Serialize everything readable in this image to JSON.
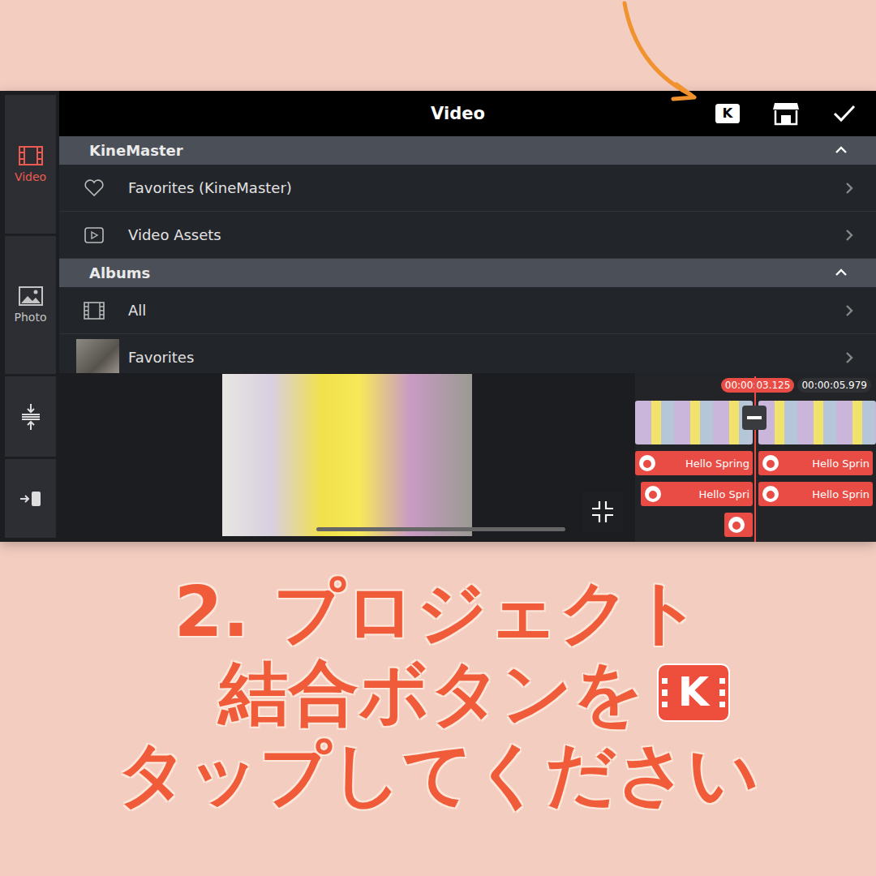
{
  "logo_letter": "K",
  "header": {
    "title": "Video"
  },
  "sidebar": {
    "tabs": [
      {
        "label": "Video",
        "selected": true
      },
      {
        "label": "Photo",
        "selected": false
      }
    ]
  },
  "sections": [
    {
      "title": "KineMaster",
      "expanded": true,
      "rows": [
        {
          "label": "Favorites (KineMaster)",
          "kind": "heart"
        },
        {
          "label": "Video Assets",
          "kind": "play"
        }
      ]
    },
    {
      "title": "Albums",
      "expanded": true,
      "rows": [
        {
          "label": "All",
          "kind": "film"
        },
        {
          "label": "Favorites",
          "kind": "thumbnail"
        }
      ]
    }
  ],
  "timeline": {
    "playhead": "00:00:03.125",
    "end": "00:00:05.979",
    "tracks": [
      [
        "Hello Spring",
        "Hello Sprin"
      ],
      [
        "Hello Spri",
        "Hello Sprin"
      ],
      [
        ""
      ]
    ]
  },
  "caption": {
    "lines": [
      "2. プロジェクト",
      "結合ボタンを",
      "タップしてください"
    ]
  }
}
